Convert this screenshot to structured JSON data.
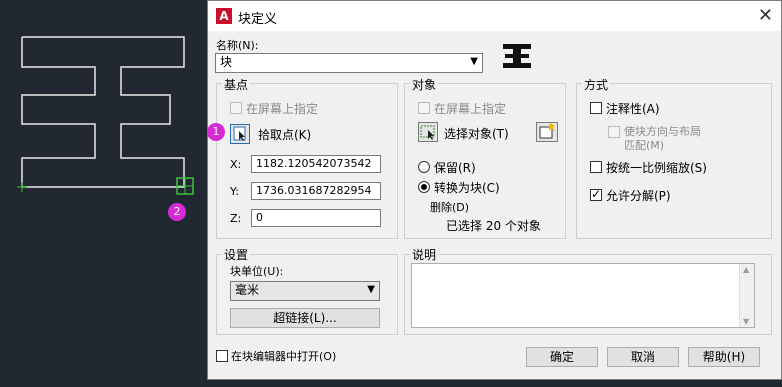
{
  "markers": {
    "one": "1",
    "two": "2"
  },
  "dialog": {
    "title": "块定义",
    "name_label": "名称(N):",
    "name_value": "块",
    "base_point": {
      "title": "基点",
      "specify_on_screen": "在屏幕上指定",
      "pick_point": "拾取点(K)",
      "x_label": "X:",
      "x_value": "1182.120542073542",
      "y_label": "Y:",
      "y_value": "1736.031687282954",
      "z_label": "Z:",
      "z_value": "0"
    },
    "objects": {
      "title": "对象",
      "specify_on_screen": "在屏幕上指定",
      "select_objects": "选择对象(T)",
      "retain": "保留(R)",
      "convert_to_block": "转换为块(C)",
      "delete": "删除(D)",
      "selected_count": "已选择 20 个对象"
    },
    "behavior": {
      "title": "方式",
      "annotative": "注释性(A)",
      "match_orientation_line1": "使块方向与布局",
      "match_orientation_line2": "匹配(M)",
      "scale_uniformly": "按统一比例缩放(S)",
      "allow_exploding": "允许分解(P)"
    },
    "settings": {
      "title": "设置",
      "block_unit_label": "块单位(U):",
      "block_unit_value": "毫米",
      "hyperlink": "超链接(L)..."
    },
    "description": {
      "title": "说明"
    },
    "open_in_editor": "在块编辑器中打开(O)",
    "ok": "确定",
    "cancel": "取消",
    "help": "帮助(H)"
  }
}
